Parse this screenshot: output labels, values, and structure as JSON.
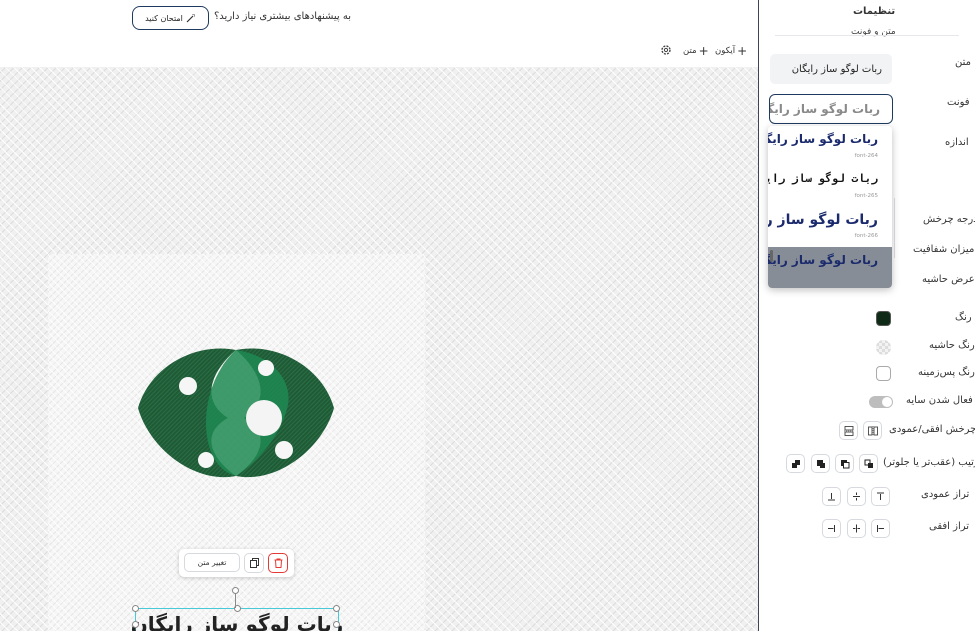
{
  "topbar": {
    "prompt": "به پیشنهادهای بیشتری نیاز دارید؟",
    "try_label": "امتحان کنید"
  },
  "toolbar": {
    "icon_label": "آیکون",
    "text_label": "متن"
  },
  "canvas": {
    "logo_text": "ربات لوگو ساز رایگان",
    "change_text_label": "تغییر متن"
  },
  "sidebar": {
    "title": "تنظیمات",
    "section": "متن و فونت",
    "text_label": "متن",
    "text_value": "ربات لوگو ساز رایگان",
    "font_label": "فونت",
    "font_value": "ربات لوگو ساز رایگان",
    "size_label": "اندازه",
    "rotation_label": "درجه چرخش",
    "opacity_label": "میزان شفافیت",
    "border_width_label": "عرض حاشیه",
    "color_label": "رنگ",
    "border_color_label": "رنگ حاشیه",
    "bg_color_label": "رنگ پس‌زمینه",
    "shadow_label": "فعال شدن سایه",
    "flip_label": "چرخش افقی/عمودی",
    "order_label": "ترتیب (عقب‌تر یا جلوتر)",
    "valign_label": "تراز عمودی",
    "halign_label": "تراز افقی"
  },
  "font_options": [
    {
      "text": "ربات لوگو ساز رایگان",
      "name": "font-264"
    },
    {
      "text": "ربات لوگو ساز رایگان",
      "name": "font-265"
    },
    {
      "text": "ربات لوگو ساز را",
      "name": "font-266"
    },
    {
      "text": "ربات لوگو ساز رایگا",
      "name": ""
    }
  ],
  "colors": {
    "accent": "#1e3a5f",
    "text_color": "#0f2a16",
    "delete": "#e53935",
    "selection": "#48c9d8"
  },
  "icons": [
    "magic-wand-icon",
    "plus-icon",
    "gear-icon",
    "copy-icon",
    "trash-icon",
    "flip-horizontal-icon",
    "flip-vertical-icon",
    "bring-front-icon",
    "send-back-icon",
    "align-top-icon",
    "align-middle-icon",
    "align-bottom-icon",
    "align-left-icon",
    "align-center-icon",
    "align-right-icon"
  ]
}
